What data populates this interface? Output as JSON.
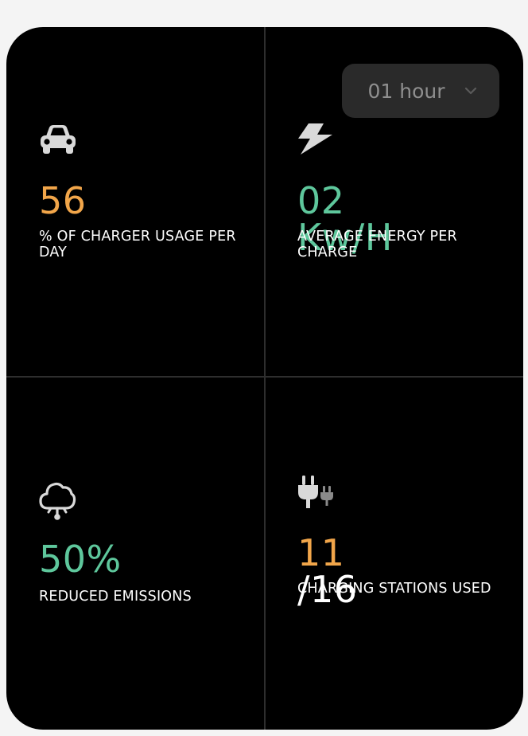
{
  "dropdown": {
    "selected": "01 hour"
  },
  "stats": {
    "usage": {
      "icon": "car-icon",
      "value": "56",
      "label": "% OF CHARGER USAGE PER DAY"
    },
    "energy": {
      "icon": "lightning-icon",
      "value": "02 Kw/H",
      "label": "AVERAGE ENERGY PER CHARGE"
    },
    "emissions": {
      "icon": "cloud-icon",
      "value": "50%",
      "label": "REDUCED EMISSIONS"
    },
    "stations": {
      "icon": "plug-icon",
      "used": "11",
      "total": "/16",
      "label": "CHARGING STATIONS USED"
    }
  },
  "colors": {
    "orange": "#f2a64a",
    "green": "#5ec79c",
    "background": "#000000",
    "divider": "#2e2e2e",
    "label": "#ffffff"
  }
}
